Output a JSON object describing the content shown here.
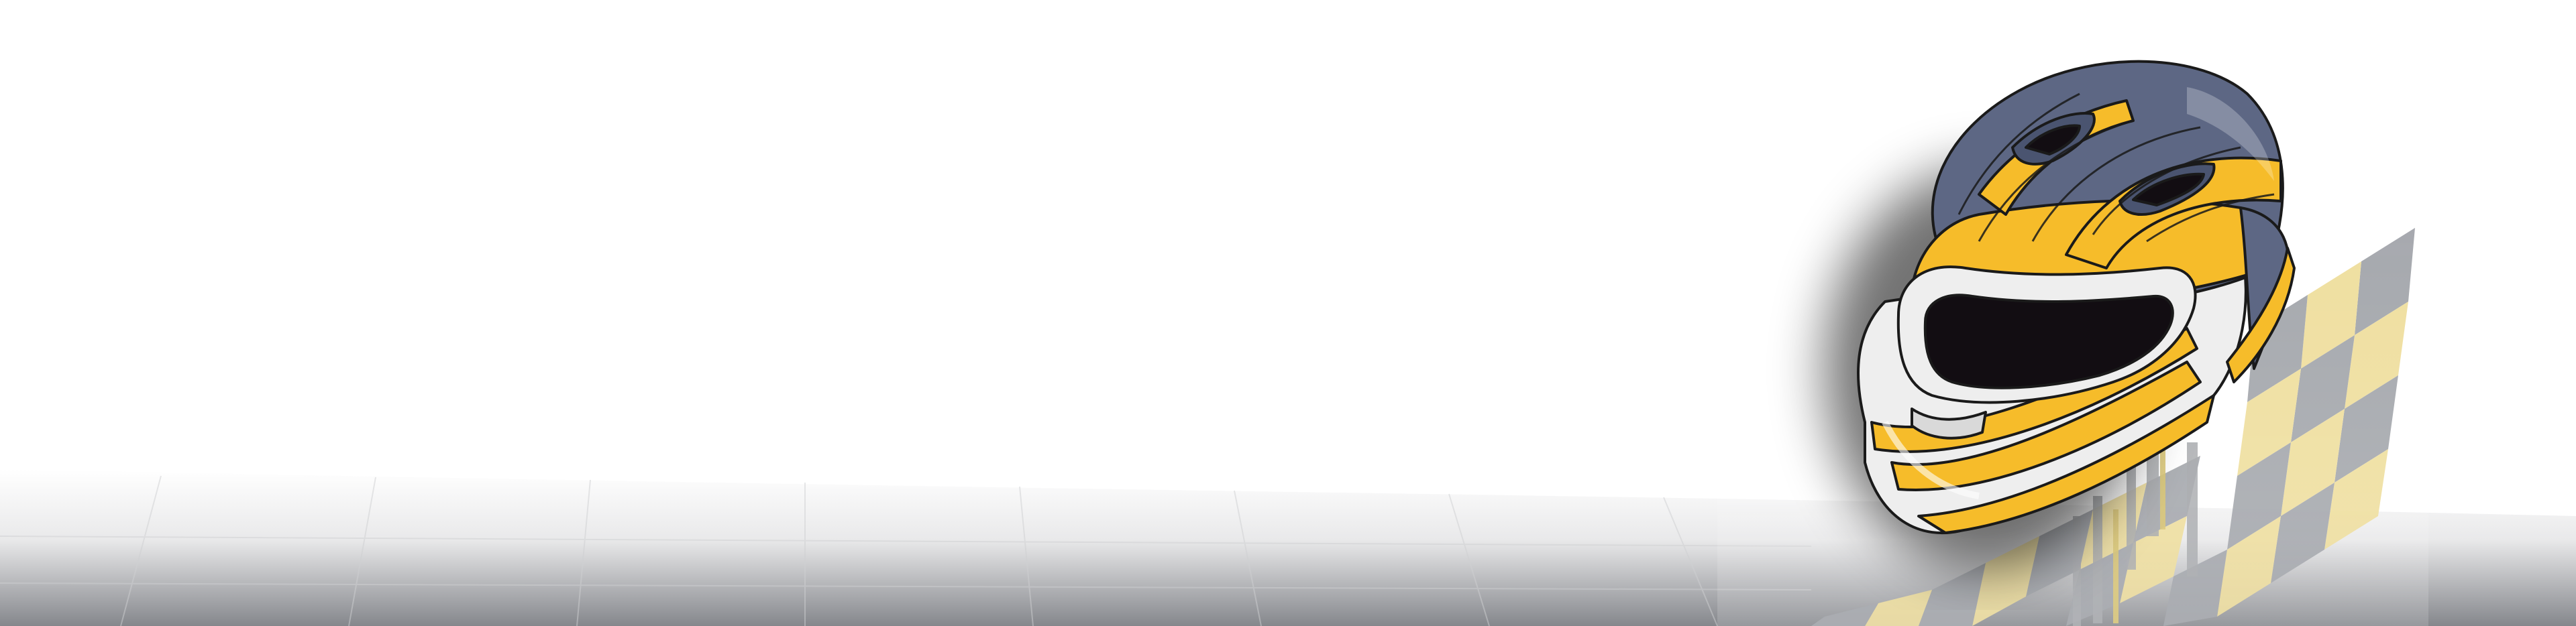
{
  "banner": {
    "graphic": "racing-helmet-checkered-flag-banner",
    "colors": {
      "background": "#ffffff",
      "ground_dark": "#8a8c90",
      "helmet_shell": "#5d6784",
      "helmet_stripe": "#f6bc2a",
      "helmet_white": "#eeeeee",
      "visor": "#120d12",
      "outline": "#1a1a1a",
      "flag_gray": "#9da0a6",
      "flag_yellow": "#eedc96"
    },
    "icons": {
      "helmet": "racing-helmet-icon",
      "flag": "checkered-flag-icon"
    }
  }
}
